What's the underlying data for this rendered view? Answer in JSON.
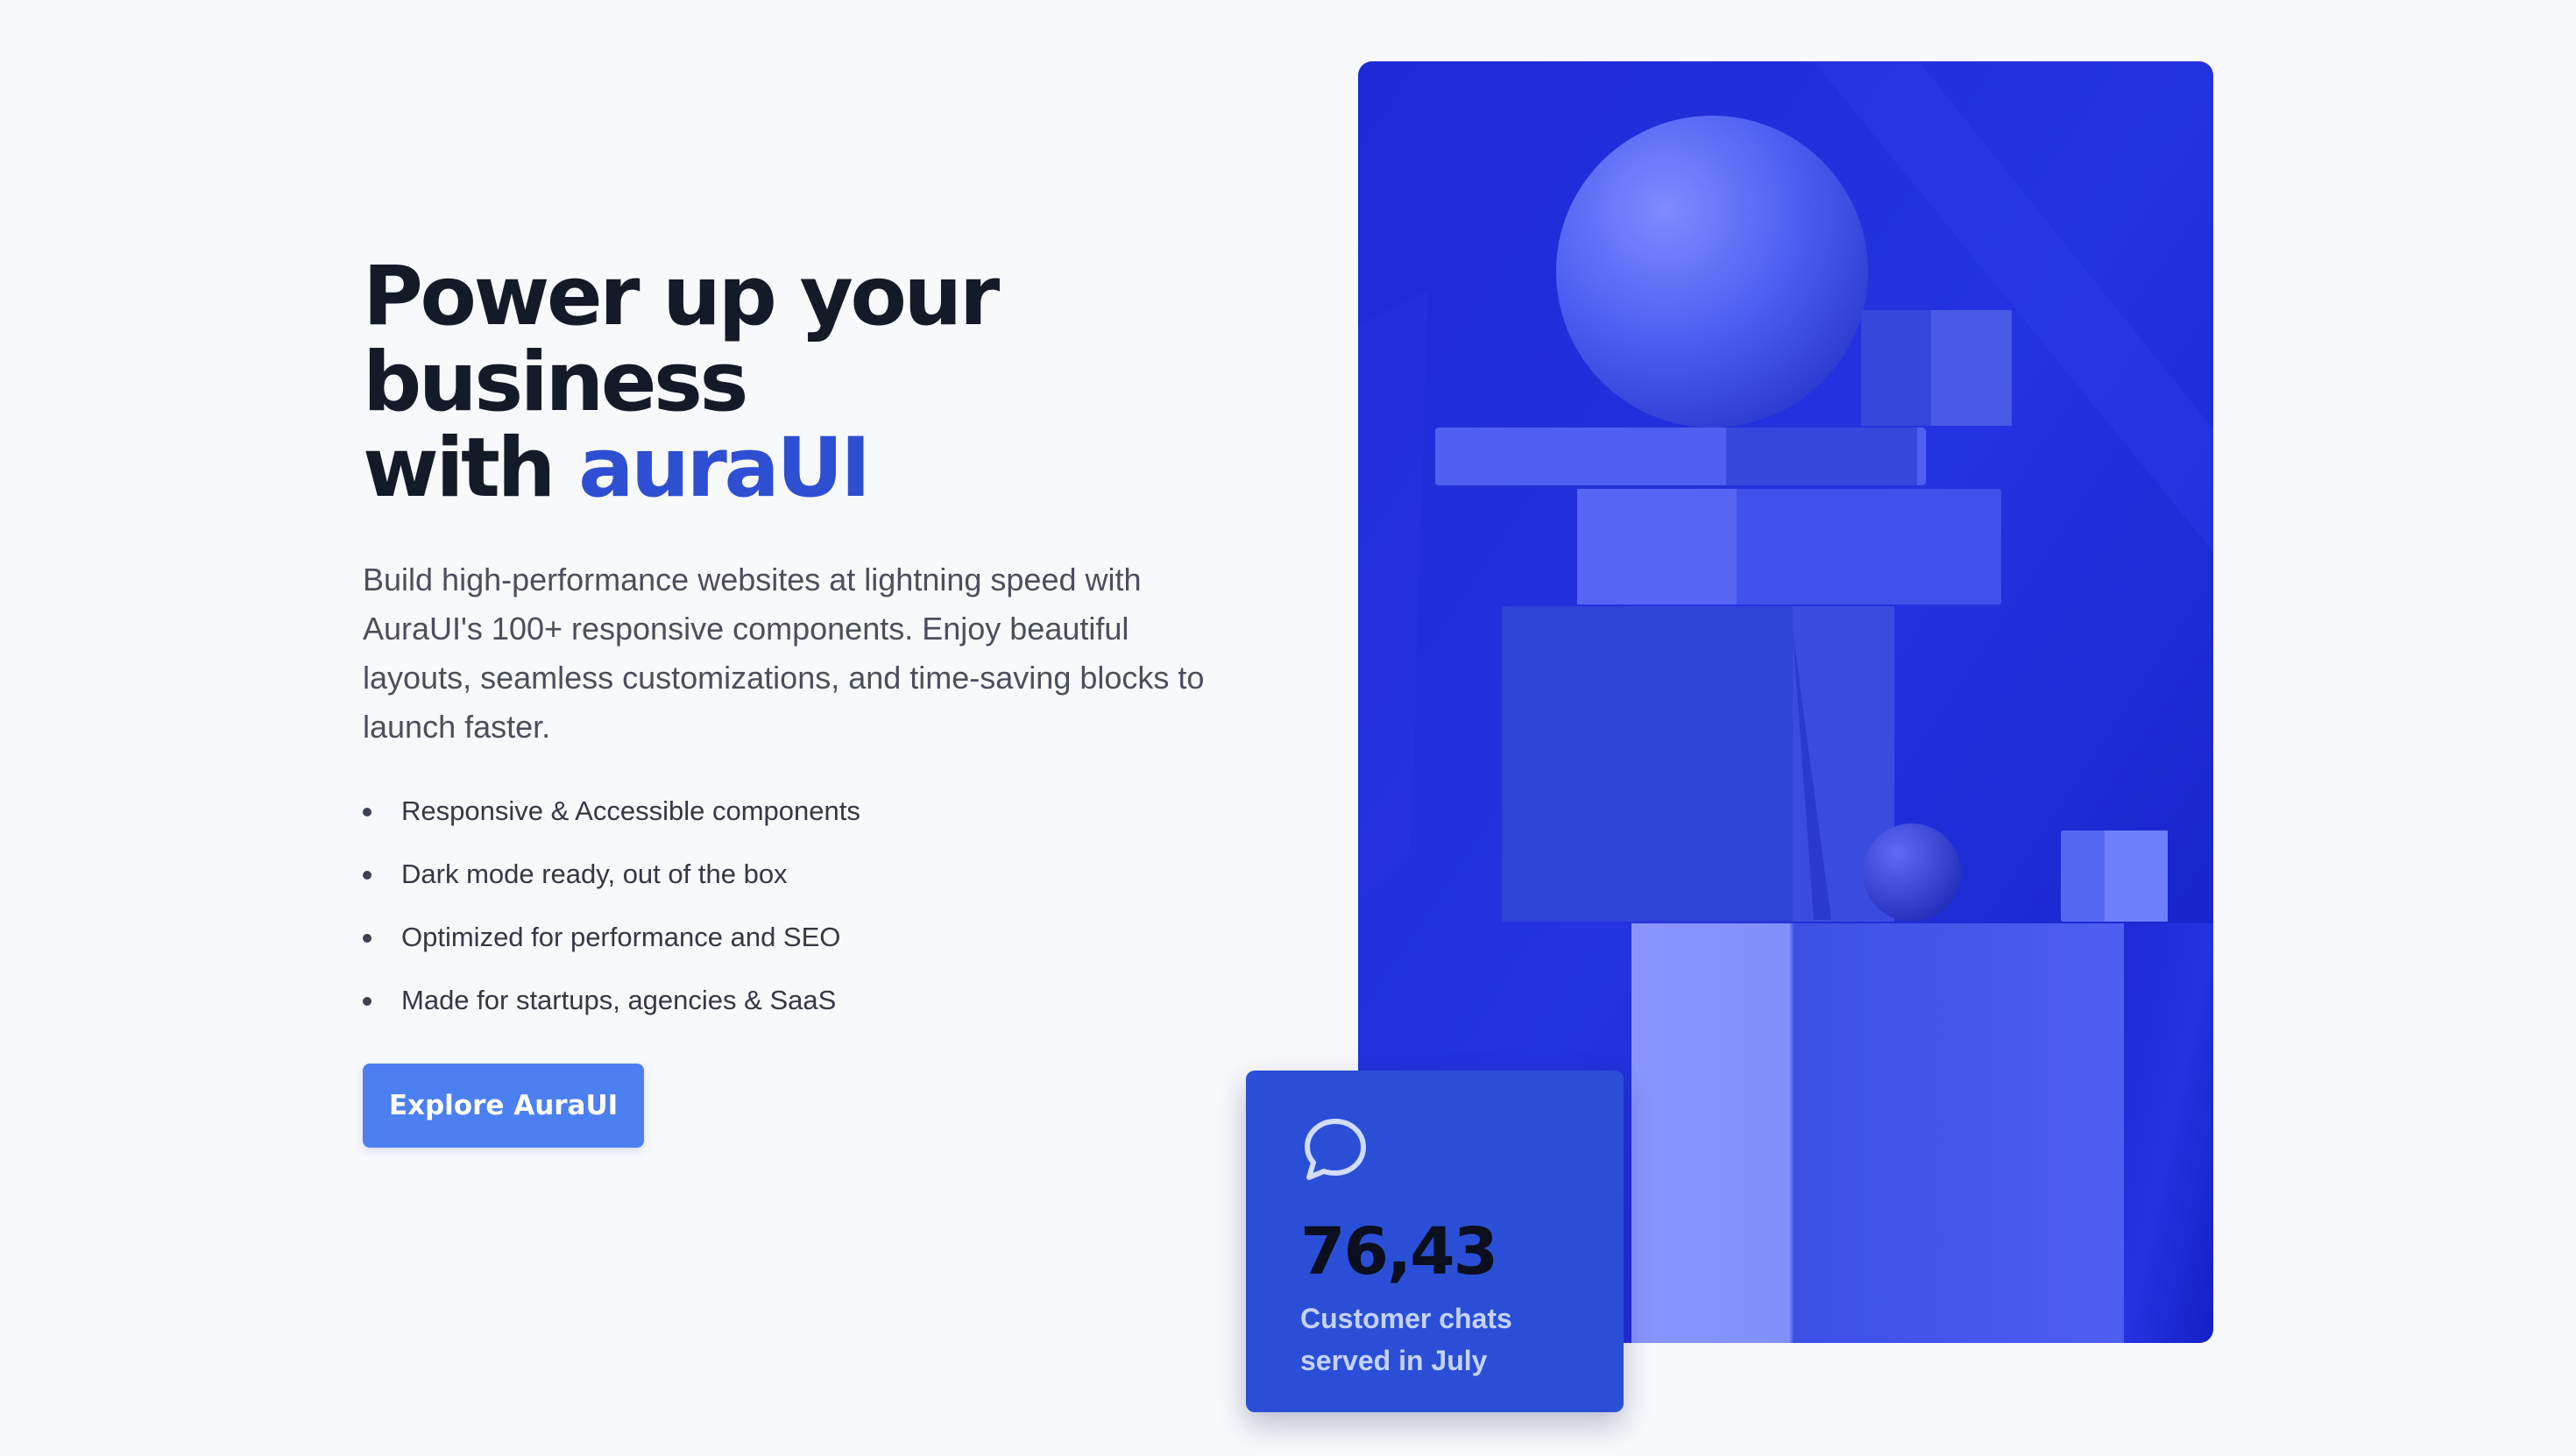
{
  "hero": {
    "headline_line1": "Power up your",
    "headline_line2": "business",
    "headline_line3_prefix": "with ",
    "headline_brand": "auraUI",
    "description": "Build high-performance websites at lightning speed with AuraUI's 100+ responsive components. Enjoy beautiful layouts, seamless customizations, and time-saving blocks to launch faster.",
    "features": [
      "Responsive & Accessible components",
      "Dark mode ready, out of the box",
      "Optimized for performance and SEO",
      "Made for startups, agencies & SaaS"
    ],
    "cta_label": "Explore AuraUI"
  },
  "stat": {
    "icon": "chat-bubble-icon",
    "value": "76,43",
    "label": "Customer chats served in July"
  },
  "colors": {
    "background": "#f8f9fb",
    "heading": "#141a28",
    "brand": "#2f4fd2",
    "cta": "#4c7ff0",
    "artwork": "#1f2ed8",
    "card": "#2a4fd6"
  }
}
